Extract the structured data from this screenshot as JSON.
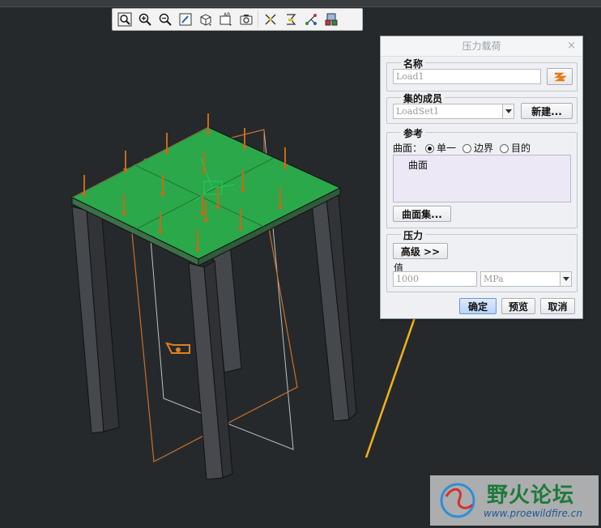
{
  "toolbar": {
    "icons": [
      "zoom-fit",
      "zoom-in",
      "zoom-out",
      "repaint",
      "display-style",
      "saved-views",
      "view-manager",
      "datum-planes",
      "datum-axes",
      "datum-points",
      "coord-systems"
    ]
  },
  "dialog": {
    "title": "压力载荷",
    "close": "×",
    "name_group": {
      "title": "名称",
      "value": "Load1"
    },
    "set_group": {
      "title": "集的成员",
      "value": "LoadSet1",
      "new_button": "新建..."
    },
    "ref_group": {
      "title": "参考",
      "type_label": "曲面：",
      "options": [
        "单一",
        "边界",
        "目的"
      ],
      "selected": "单一",
      "list_item": "曲面",
      "surface_set_button": "曲面集..."
    },
    "pressure_group": {
      "title": "压力",
      "advanced_button": "高级 >>",
      "value_label": "值",
      "value": "1000",
      "unit": "MPa"
    },
    "buttons": {
      "ok": "确定",
      "preview": "预览",
      "cancel": "取消"
    }
  },
  "model": {
    "plate_color": "#2aa84a",
    "leg_color": "#3b3e43",
    "arrow_color": "#c66a17",
    "orange_outline": "#c8702a"
  },
  "watermark": {
    "title": "野火论坛",
    "url": "www.proewildfire.cn"
  }
}
